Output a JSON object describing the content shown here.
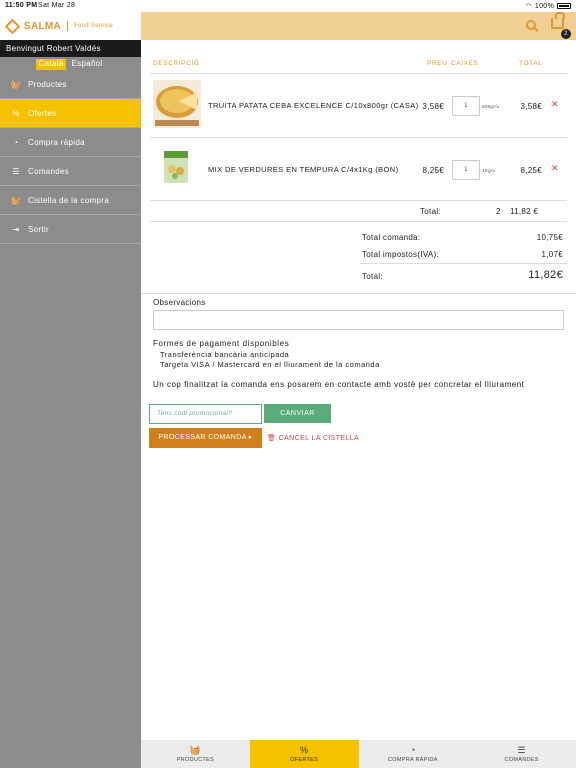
{
  "status": {
    "time": "11:50 PM",
    "date": "Sat Mar 28",
    "battery": "100%"
  },
  "brand": {
    "name": "SALMA",
    "sub": "Food Service",
    "color": "#e2972a"
  },
  "sidebar": {
    "welcome": "Benvingut Robert Valdés",
    "lang_active": "Català",
    "lang_other": "Español",
    "items": [
      {
        "label": "Productes",
        "icon": "basket-icon"
      },
      {
        "label": "Ofertes",
        "icon": "percent-icon"
      },
      {
        "label": "Compra ràpida",
        "icon": "speedometer-icon"
      },
      {
        "label": "Comandes",
        "icon": "list-icon"
      },
      {
        "label": "Cistella de la compra",
        "icon": "basket-icon"
      },
      {
        "label": "Sortir",
        "icon": "logout-icon"
      }
    ]
  },
  "header": {
    "cart_count": "2"
  },
  "table": {
    "headers": {
      "desc": "DESCRIPCIÓ",
      "price": "PREU",
      "boxes": "CAIXES",
      "total": "TOTAL"
    },
    "rows": [
      {
        "name": "TRUITA PATATA CEBA EXCELENCE C/10x800gr (CASA)",
        "price": "3,58€",
        "qty": "1",
        "unit": "800gr/u",
        "total": "3,58€"
      },
      {
        "name": "MIX DE VERDURES EN TEMPURA C/4x1Kg (BON)",
        "price": "8,25€",
        "qty": "1",
        "unit": "1Kg/u",
        "total": "8,25€"
      }
    ],
    "total_label": "Total:",
    "total_boxes": "2",
    "total_value": "11,82 €"
  },
  "summary": {
    "order_label": "Total comanda:",
    "order_value": "10,75€",
    "tax_label": "Total impostos(IVA):",
    "tax_value": "1,07€",
    "grand_label": "Total:",
    "grand_value": "11,82€"
  },
  "observations_label": "Observacions",
  "payment": {
    "title": "Formes de pagament disponibles",
    "methods": [
      "Transferència bancària anticipada",
      "Targeta VISA / Mastercard en el lliurament de la comanda"
    ]
  },
  "notice": "Un cop finalitzat la comanda ens posarem en contacte amb vostè per concretar el lliurament",
  "promo": {
    "placeholder": "Tens codi promocional?",
    "button": "CANVIAR"
  },
  "actions": {
    "process": "PROCESSAR COMANDA ▸",
    "cancel": "CANCEL LA CISTELLA"
  },
  "tabs": [
    {
      "label": "PRODUCTES",
      "icon": "basket-icon"
    },
    {
      "label": "OFERTES",
      "icon": "percent-icon"
    },
    {
      "label": "COMPRA RÀPIDA",
      "icon": "speedometer-icon"
    },
    {
      "label": "COMANDES",
      "icon": "list-icon"
    }
  ]
}
